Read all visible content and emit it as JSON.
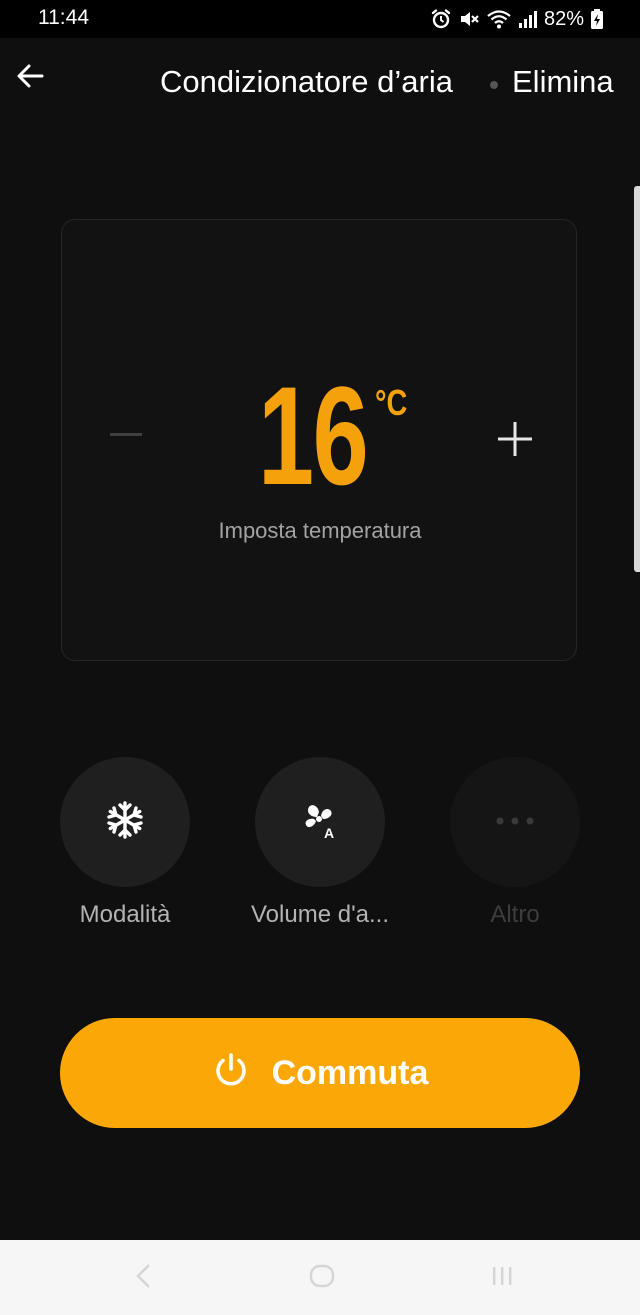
{
  "status_bar": {
    "time": "11:44",
    "battery": "82%",
    "icons": [
      "alarm-icon",
      "mute-icon",
      "wifi-icon",
      "signal-icon",
      "battery-charging-icon"
    ]
  },
  "header": {
    "back_icon": "arrow-left-icon",
    "title": "Condizionatore d’aria",
    "delete_label": "Elimina"
  },
  "temperature": {
    "value": "16",
    "unit": "°C",
    "label": "Imposta temperatura",
    "decrease_icon": "minus-icon",
    "increase_icon": "plus-icon"
  },
  "controls": [
    {
      "label": "Modalità",
      "icon": "snowflake-icon",
      "enabled": true
    },
    {
      "label": "Volume d'a...",
      "icon": "fan-auto-icon",
      "enabled": true
    },
    {
      "label": "Altro",
      "icon": "more-dots-icon",
      "enabled": false
    }
  ],
  "toggle": {
    "label": "Commuta",
    "icon": "power-icon"
  },
  "nav_bar": {
    "icons": [
      "nav-back-icon",
      "nav-home-icon",
      "nav-recents-icon"
    ]
  },
  "colors": {
    "accent": "#f5a10b",
    "button": "#fba807",
    "background": "#0f0f0f"
  }
}
